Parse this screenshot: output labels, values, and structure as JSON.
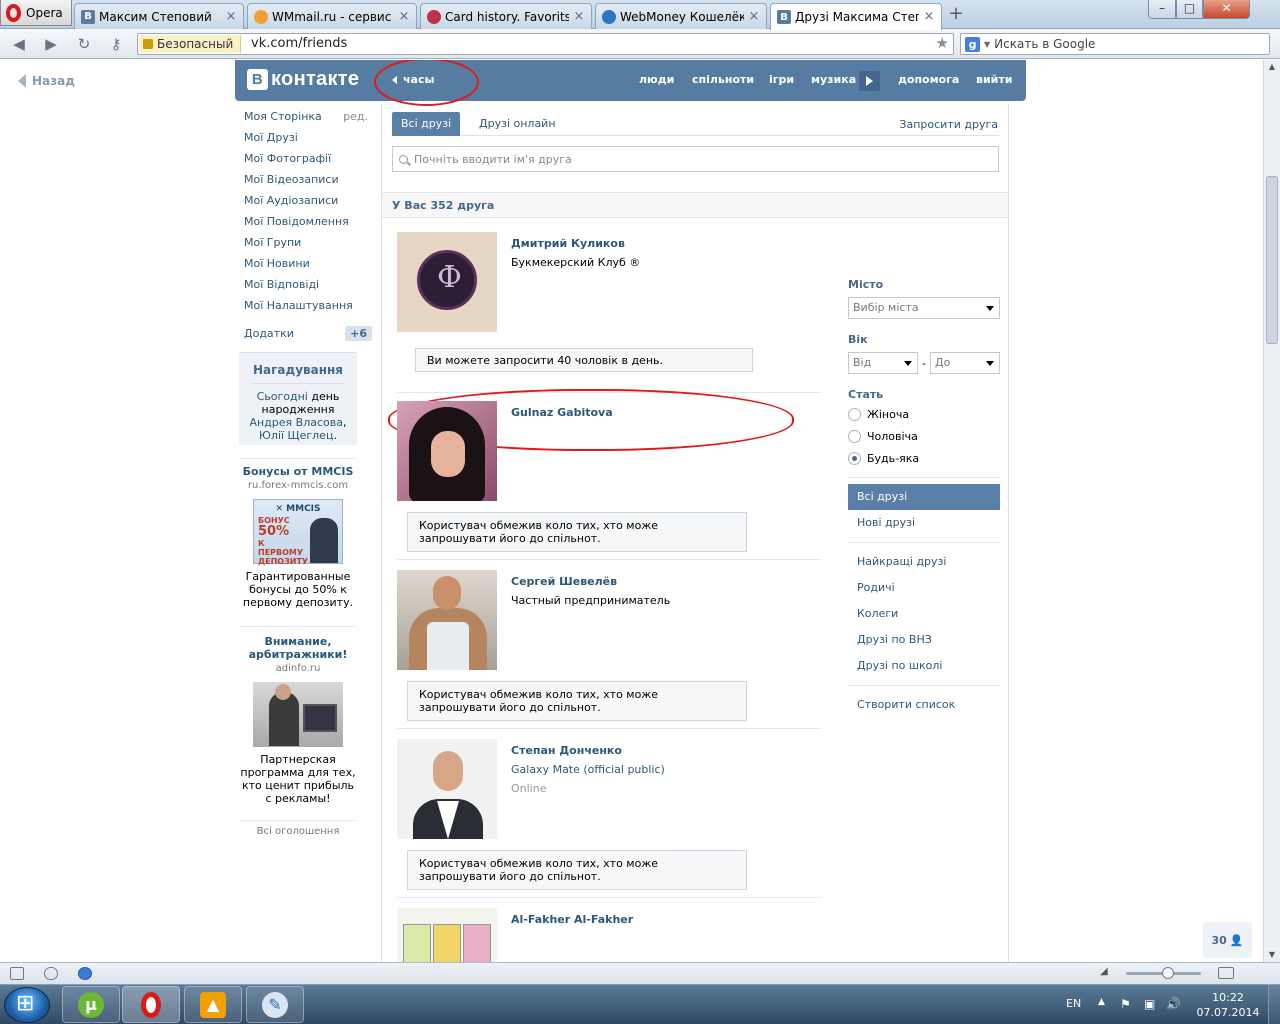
{
  "browser": {
    "menu_label": "Opera",
    "tabs": [
      {
        "title": "Максим Степовий",
        "favicon": "vk-icon",
        "color": "#577ca2",
        "letter": "B"
      },
      {
        "title": "WMmail.ru - сервис п...",
        "favicon": "wmmail-icon",
        "color": "#f0a030",
        "letter": ""
      },
      {
        "title": "Card history. Favoritsp...",
        "favicon": "card-icon",
        "color": "#c0304a",
        "letter": ""
      },
      {
        "title": "WebMoney Кошелёк »...",
        "favicon": "webmoney-icon",
        "color": "#2f74c0",
        "letter": ""
      },
      {
        "title": "Друзі Максима Степо...",
        "favicon": "vk-icon",
        "color": "#577ca2",
        "letter": "B"
      }
    ],
    "new_tab": "+",
    "security_label": "Безопасный",
    "url": "vk.com/friends",
    "search_placeholder": "Искать в Google"
  },
  "page": {
    "back_label": "Назад",
    "logo_text": "контакте",
    "logo_letter": "B",
    "header_back": "часы",
    "top_nav": [
      "люди",
      "спільноти",
      "ігри",
      "музика",
      "допомога",
      "вийти"
    ],
    "left_menu": [
      "Моя Сторінка",
      "Мої Друзі",
      "Мої Фотографії",
      "Мої Відеозаписи",
      "Мої Аудіозаписи",
      "Мої Повідомлення",
      "Мої Групи",
      "Мої Новини",
      "Мої Відповіді",
      "Мої Налаштування"
    ],
    "edit_label": "ред.",
    "apps_label": "Додатки",
    "apps_badge": "+6",
    "reminder": {
      "title": "Нагадування",
      "today": "Сьогодні",
      "text1": " день народження ",
      "name1": "Андрея Власова",
      "text2": ", ",
      "name2": "Юлії Щеглец",
      "text3": "."
    },
    "ads": [
      {
        "title": "Бонусы от MMCIS",
        "domain": "ru.forex-mmcis.com",
        "image_brand": "✕ MMCIS",
        "image_line1": "БОНУС",
        "image_line2": "50%",
        "image_line3": "К ПЕРВОМУ ДЕПОЗИТУ",
        "desc": "Гарантированные бонусы до 50% к первому депозиту."
      },
      {
        "title": "Внимание, арбитражники!",
        "domain": "adinfo.ru",
        "desc": "Партнерская программа для тех, кто ценит прибыль с рекламы!"
      }
    ],
    "all_ads": "Всі оголошення",
    "tabs": [
      "Всі друзі",
      "Друзі онлайн"
    ],
    "invite": "Запросити друга",
    "search_placeholder": "Почніть вводити ім'я друга",
    "friends_count": "У Вас 352 друга",
    "friends": [
      {
        "name": "Дмитрий Куликов",
        "sub": "Букмекерский Клуб ®",
        "note": "Ви можете запросити 40 чоловік в день."
      },
      {
        "name": "Gulnaz Gabitova",
        "sub": "",
        "note": "Користувач обмежив коло тих, хто може запрошувати його до спільнот."
      },
      {
        "name": "Сергей Шевелёв",
        "sub": "Частный предприниматель",
        "note": "Користувач обмежив коло тих, хто може запрошувати його до спільнот."
      },
      {
        "name": "Степан Донченко",
        "sub": "Galaxy Mate (official public)",
        "online": "Online",
        "note": "Користувач обмежив коло тих, хто може запрошувати його до спільнот."
      },
      {
        "name": "Al-Fakher Al-Fakher",
        "sub": "",
        "note": ""
      }
    ],
    "filters": {
      "city_label": "Місто",
      "city_value": "Вибір міста",
      "age_label": "Вік",
      "age_from": "Від",
      "age_dash": "-",
      "age_to": "До",
      "gender_label": "Стать",
      "gender_options": [
        "Жіноча",
        "Чоловіча",
        "Будь-яка"
      ],
      "gender_selected": 2
    },
    "side_links": [
      "Всі друзі",
      "Нові друзі",
      "Найкращі друзі",
      "Родичі",
      "Колеги",
      "Друзі по ВНЗ",
      "Друзі по школі",
      "Створити список"
    ],
    "online_counter": "30"
  },
  "taskbar": {
    "language": "EN",
    "time": "10:22",
    "date": "07.07.2014"
  },
  "colors": {
    "vk_header": "#577ca2",
    "link": "#2b587a",
    "annotation": "#e0191b"
  }
}
